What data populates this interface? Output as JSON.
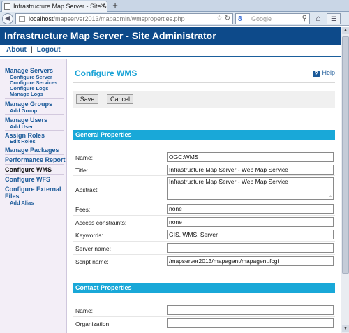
{
  "browser": {
    "tab_title": "Infrastructure Map Server - Site Administrat...",
    "tab_close": "×",
    "new_tab": "+",
    "url_host": "localhost",
    "url_path": "/mapserver2013/mapadmin/wmsproperties.php",
    "search_placeholder": "Google"
  },
  "header": {
    "site_title": "Infrastructure Map Server - Site Administrator"
  },
  "topnav": {
    "about": "About",
    "separator": "|",
    "logout": "Logout"
  },
  "sidebar": {
    "manage_servers": "Manage Servers",
    "configure_server": "Configure Server",
    "configure_services": "Configure Services",
    "configure_logs": "Configure Logs",
    "manage_logs": "Manage Logs",
    "manage_groups": "Manage Groups",
    "add_group": "Add Group",
    "manage_users": "Manage Users",
    "add_user": "Add User",
    "assign_roles": "Assign Roles",
    "edit_roles": "Edit Roles",
    "manage_packages": "Manage Packages",
    "performance_report": "Performance Report",
    "configure_wms": "Configure WMS",
    "configure_wfs": "Configure WFS",
    "configure_external_1": "Configure External",
    "configure_external_2": "Files",
    "add_alias": "Add Alias"
  },
  "main": {
    "title": "Configure WMS",
    "help": "Help",
    "save": "Save",
    "cancel": "Cancel",
    "general_section": "General Properties",
    "contact_section": "Contact Properties"
  },
  "general": {
    "name_label": "Name:",
    "name_value": "OGC:WMS",
    "title_label": "Title:",
    "title_value": "Infrastructure Map Server - Web Map Service",
    "abstract_label": "Abstract:",
    "abstract_value": "Infrastructure Map Server - Web Map Service",
    "fees_label": "Fees:",
    "fees_value": "none",
    "access_label": "Access constraints:",
    "access_value": "none",
    "keywords_label": "Keywords:",
    "keywords_value": "GIS, WMS, Server",
    "server_name_label": "Server name:",
    "server_name_value": "",
    "script_name_label": "Script name:",
    "script_name_value": "/mapserver2013/mapagent/mapagent.fcgi"
  },
  "contact": {
    "name_label": "Name:",
    "name_value": "",
    "org_label": "Organization:",
    "org_value": ""
  }
}
